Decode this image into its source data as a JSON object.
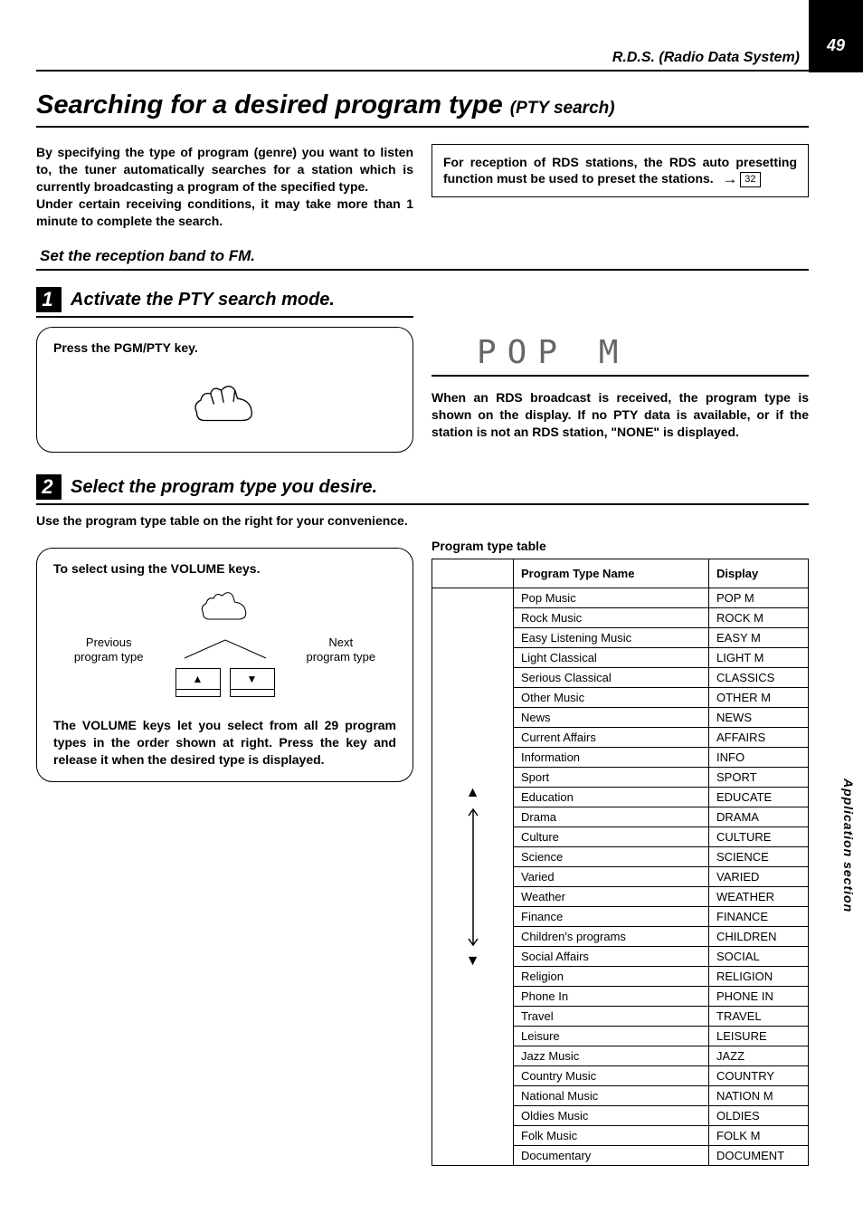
{
  "page_number": "49",
  "header_section": "R.D.S. (Radio Data System)",
  "title_main": "Searching for a desired program type",
  "title_sub": "(PTY search)",
  "intro": "By specifying the type of program (genre) you want to listen to, the tuner automatically searches for a station which is currently broadcasting a program of the specified type.\nUnder certain receiving conditions, it may take more than 1 minute to complete the search.",
  "note_box": "For reception of RDS stations, the RDS auto presetting function must be used to preset the stations.",
  "note_page_ref": "32",
  "band_instruction": "Set the reception band to FM.",
  "step1": {
    "num": "1",
    "title": "Activate the PTY search mode.",
    "bubble_head": "Press the PGM/PTY key."
  },
  "display_text": "POP  M",
  "display_note": "When an RDS broadcast is received, the program type is shown on the display.  If no PTY data is available, or if the station is not an RDS station, \"NONE\" is displayed.",
  "step2": {
    "num": "2",
    "title": "Select the program type you desire.",
    "subtitle": "Use the program type table on the right for your convenience.",
    "vol_head": "To select using the VOLUME keys.",
    "prev_label": "Previous\nprogram type",
    "next_label": "Next\nprogram type",
    "vol_note": "The VOLUME keys let you select from all 29 program types in the order shown at right. Press the key and release it when the desired type is displayed."
  },
  "table_title": "Program type table",
  "table_headers": {
    "col1": "Program Type Name",
    "col2": "Display"
  },
  "pty_rows": [
    {
      "name": "Pop Music",
      "disp": "POP M"
    },
    {
      "name": "Rock Music",
      "disp": "ROCK M"
    },
    {
      "name": "Easy Listening Music",
      "disp": "EASY M"
    },
    {
      "name": "Light Classical",
      "disp": "LIGHT M"
    },
    {
      "name": "Serious Classical",
      "disp": "CLASSICS"
    },
    {
      "name": "Other Music",
      "disp": "OTHER M"
    },
    {
      "name": "News",
      "disp": "NEWS"
    },
    {
      "name": "Current Affairs",
      "disp": "AFFAIRS"
    },
    {
      "name": "Information",
      "disp": "INFO"
    },
    {
      "name": "Sport",
      "disp": "SPORT"
    },
    {
      "name": "Education",
      "disp": "EDUCATE"
    },
    {
      "name": "Drama",
      "disp": "DRAMA"
    },
    {
      "name": "Culture",
      "disp": "CULTURE"
    },
    {
      "name": "Science",
      "disp": "SCIENCE"
    },
    {
      "name": "Varied",
      "disp": "VARIED"
    },
    {
      "name": "Weather",
      "disp": "WEATHER"
    },
    {
      "name": "Finance",
      "disp": "FINANCE"
    },
    {
      "name": "Children's programs",
      "disp": "CHILDREN"
    },
    {
      "name": "Social Affairs",
      "disp": "SOCIAL"
    },
    {
      "name": "Religion",
      "disp": "RELIGION"
    },
    {
      "name": "Phone In",
      "disp": "PHONE IN"
    },
    {
      "name": "Travel",
      "disp": "TRAVEL"
    },
    {
      "name": "Leisure",
      "disp": "LEISURE"
    },
    {
      "name": "Jazz Music",
      "disp": "JAZZ"
    },
    {
      "name": "Country Music",
      "disp": "COUNTRY"
    },
    {
      "name": "National Music",
      "disp": "NATION M"
    },
    {
      "name": "Oldies Music",
      "disp": "OLDIES"
    },
    {
      "name": "Folk Music",
      "disp": "FOLK M"
    },
    {
      "name": "Documentary",
      "disp": "DOCUMENT"
    }
  ],
  "side_tab": "Application section"
}
